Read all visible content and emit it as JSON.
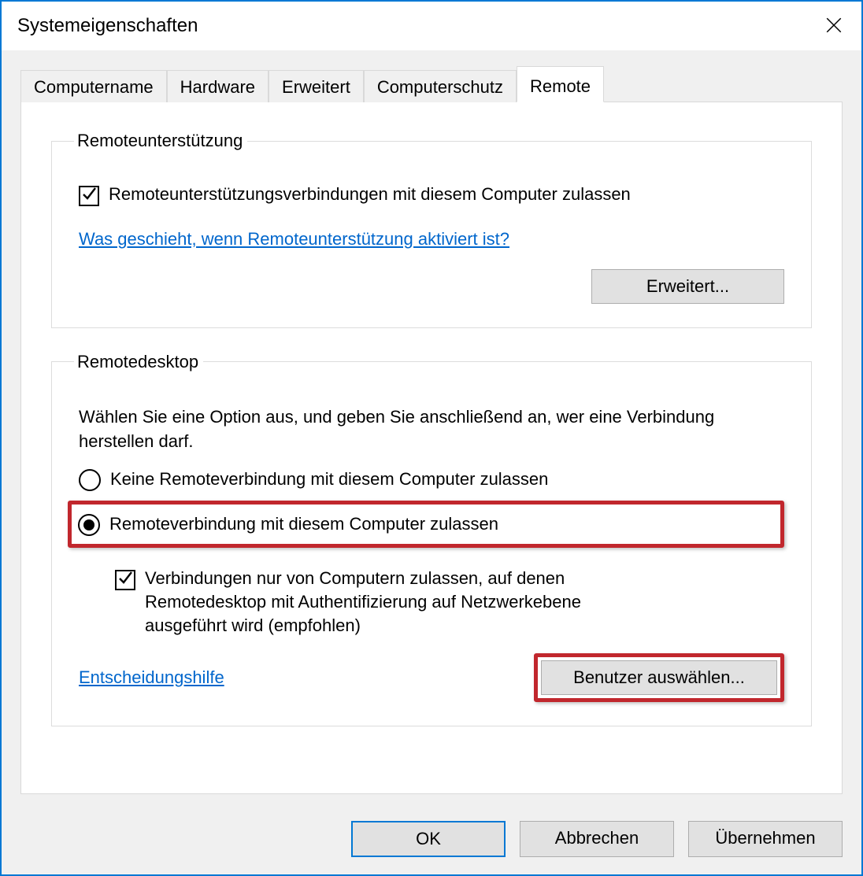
{
  "window": {
    "title": "Systemeigenschaften"
  },
  "tabs": {
    "computername": "Computername",
    "hardware": "Hardware",
    "advanced": "Erweitert",
    "protection": "Computerschutz",
    "remote": "Remote"
  },
  "remoteAssistance": {
    "legend": "Remoteunterstützung",
    "allow_checkbox": "Remoteunterstützungsverbindungen mit diesem Computer zulassen",
    "help_link": "Was geschieht, wenn Remoteunterstützung aktiviert ist?",
    "advanced_button": "Erweitert..."
  },
  "remoteDesktop": {
    "legend": "Remotedesktop",
    "description": "Wählen Sie eine Option aus, und geben Sie anschließend an, wer eine Verbindung herstellen darf.",
    "radio_deny": "Keine Remoteverbindung mit diesem Computer zulassen",
    "radio_allow": "Remoteverbindung mit diesem Computer zulassen",
    "nla_checkbox": "Verbindungen nur von Computern zulassen, auf denen Remotedesktop mit Authentifizierung auf Netzwerkebene ausgeführt wird (empfohlen)",
    "help_link": "Entscheidungshilfe",
    "select_users_button": "Benutzer auswählen..."
  },
  "footer": {
    "ok": "OK",
    "cancel": "Abbrechen",
    "apply": "Übernehmen"
  }
}
